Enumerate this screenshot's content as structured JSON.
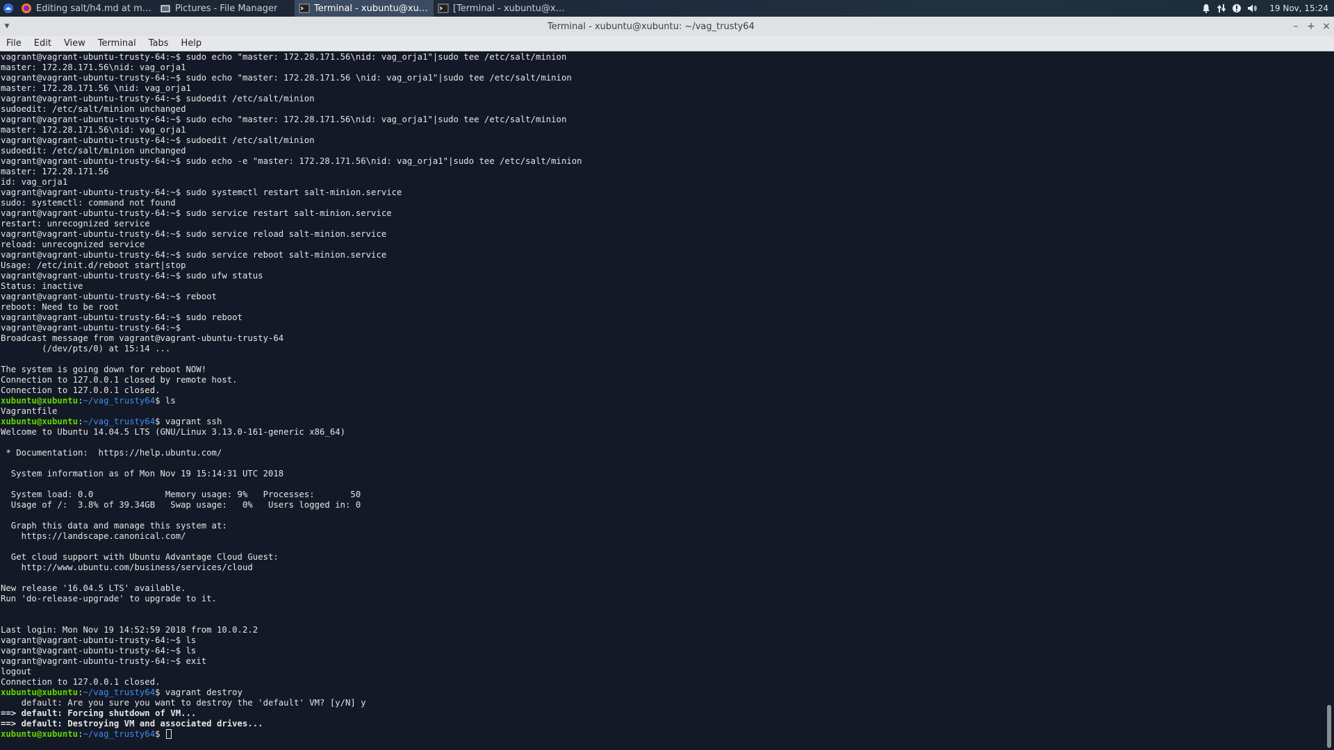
{
  "taskbar": {
    "tasks": [
      {
        "label": "Editing salt/h4.md at master ...",
        "icon": "firefox-icon",
        "active": false
      },
      {
        "label": "Pictures - File Manager",
        "icon": "file-manager-icon",
        "active": false
      },
      {
        "label": "Terminal - xubuntu@xubuntu...",
        "icon": "terminal-icon",
        "active": true
      },
      {
        "label": "[Terminal - xubuntu@xubunt...",
        "icon": "terminal-icon",
        "active": false
      }
    ],
    "tray_icons": [
      "bell-icon",
      "network-icon",
      "update-icon",
      "volume-icon"
    ],
    "clock": "19 Nov, 15:24"
  },
  "window": {
    "title": "Terminal - xubuntu@xubuntu: ~/vag_trusty64",
    "controls": {
      "minimize": "–",
      "maximize": "+",
      "close": "×"
    }
  },
  "menubar": {
    "items": [
      "File",
      "Edit",
      "View",
      "Terminal",
      "Tabs",
      "Help"
    ]
  },
  "colors": {
    "terminal_bg": "#131926",
    "prompt_user": "#5fd700",
    "prompt_path": "#3f8df0",
    "text": "#e6e6e6"
  },
  "terminal": {
    "lines": [
      {
        "text": "vagrant@vagrant-ubuntu-trusty-64:~$ sudo echo \"master: 172.28.171.56\\nid: vag_orja1\"|sudo tee /etc/salt/minion"
      },
      {
        "text": "master: 172.28.171.56\\nid: vag_orja1"
      },
      {
        "text": "vagrant@vagrant-ubuntu-trusty-64:~$ sudo echo \"master: 172.28.171.56 \\nid: vag_orja1\"|sudo tee /etc/salt/minion"
      },
      {
        "text": "master: 172.28.171.56 \\nid: vag_orja1"
      },
      {
        "text": "vagrant@vagrant-ubuntu-trusty-64:~$ sudoedit /etc/salt/minion"
      },
      {
        "text": "sudoedit: /etc/salt/minion unchanged"
      },
      {
        "text": "vagrant@vagrant-ubuntu-trusty-64:~$ sudo echo \"master: 172.28.171.56\\nid: vag_orja1\"|sudo tee /etc/salt/minion"
      },
      {
        "text": "master: 172.28.171.56\\nid: vag_orja1"
      },
      {
        "text": "vagrant@vagrant-ubuntu-trusty-64:~$ sudoedit /etc/salt/minion"
      },
      {
        "text": "sudoedit: /etc/salt/minion unchanged"
      },
      {
        "text": "vagrant@vagrant-ubuntu-trusty-64:~$ sudo echo -e \"master: 172.28.171.56\\nid: vag_orja1\"|sudo tee /etc/salt/minion"
      },
      {
        "text": "master: 172.28.171.56"
      },
      {
        "text": "id: vag_orja1"
      },
      {
        "text": "vagrant@vagrant-ubuntu-trusty-64:~$ sudo systemctl restart salt-minion.service"
      },
      {
        "text": "sudo: systemctl: command not found"
      },
      {
        "text": "vagrant@vagrant-ubuntu-trusty-64:~$ sudo service restart salt-minion.service"
      },
      {
        "text": "restart: unrecognized service"
      },
      {
        "text": "vagrant@vagrant-ubuntu-trusty-64:~$ sudo service reload salt-minion.service"
      },
      {
        "text": "reload: unrecognized service"
      },
      {
        "text": "vagrant@vagrant-ubuntu-trusty-64:~$ sudo service reboot salt-minion.service"
      },
      {
        "text": "Usage: /etc/init.d/reboot start|stop"
      },
      {
        "text": "vagrant@vagrant-ubuntu-trusty-64:~$ sudo ufw status"
      },
      {
        "text": "Status: inactive"
      },
      {
        "text": "vagrant@vagrant-ubuntu-trusty-64:~$ reboot"
      },
      {
        "text": "reboot: Need to be root"
      },
      {
        "text": "vagrant@vagrant-ubuntu-trusty-64:~$ sudo reboot"
      },
      {
        "text": "vagrant@vagrant-ubuntu-trusty-64:~$"
      },
      {
        "text": "Broadcast message from vagrant@vagrant-ubuntu-trusty-64"
      },
      {
        "text": "        (/dev/pts/0) at 15:14 ..."
      },
      {
        "text": ""
      },
      {
        "text": "The system is going down for reboot NOW!"
      },
      {
        "text": "Connection to 127.0.0.1 closed by remote host."
      },
      {
        "text": "Connection to 127.0.0.1 closed."
      },
      {
        "user": "xubuntu@xubuntu",
        "path": "~/vag_trusty64",
        "cmd": "$ ls"
      },
      {
        "text": "Vagrantfile"
      },
      {
        "user": "xubuntu@xubuntu",
        "path": "~/vag_trusty64",
        "cmd": "$ vagrant ssh"
      },
      {
        "text": "Welcome to Ubuntu 14.04.5 LTS (GNU/Linux 3.13.0-161-generic x86_64)"
      },
      {
        "text": ""
      },
      {
        "text": " * Documentation:  https://help.ubuntu.com/"
      },
      {
        "text": ""
      },
      {
        "text": "  System information as of Mon Nov 19 15:14:31 UTC 2018"
      },
      {
        "text": ""
      },
      {
        "text": "  System load: 0.0              Memory usage: 9%   Processes:       50"
      },
      {
        "text": "  Usage of /:  3.8% of 39.34GB   Swap usage:   0%   Users logged in: 0"
      },
      {
        "text": ""
      },
      {
        "text": "  Graph this data and manage this system at:"
      },
      {
        "text": "    https://landscape.canonical.com/"
      },
      {
        "text": ""
      },
      {
        "text": "  Get cloud support with Ubuntu Advantage Cloud Guest:"
      },
      {
        "text": "    http://www.ubuntu.com/business/services/cloud"
      },
      {
        "text": ""
      },
      {
        "text": "New release '16.04.5 LTS' available."
      },
      {
        "text": "Run 'do-release-upgrade' to upgrade to it."
      },
      {
        "text": ""
      },
      {
        "text": ""
      },
      {
        "text": "Last login: Mon Nov 19 14:52:59 2018 from 10.0.2.2"
      },
      {
        "text": "vagrant@vagrant-ubuntu-trusty-64:~$ ls"
      },
      {
        "text": "vagrant@vagrant-ubuntu-trusty-64:~$ ls"
      },
      {
        "text": "vagrant@vagrant-ubuntu-trusty-64:~$ exit"
      },
      {
        "text": "logout"
      },
      {
        "text": "Connection to 127.0.0.1 closed."
      },
      {
        "user": "xubuntu@xubuntu",
        "path": "~/vag_trusty64",
        "cmd": "$ vagrant destroy"
      },
      {
        "text": "    default: Are you sure you want to destroy the 'default' VM? [y/N] y"
      },
      {
        "text": "==> default: Forcing shutdown of VM...",
        "bold": true
      },
      {
        "text": "==> default: Destroying VM and associated drives...",
        "bold": true
      },
      {
        "user": "xubuntu@xubuntu",
        "path": "~/vag_trusty64",
        "cmd": "$ ",
        "cursor": true
      }
    ]
  }
}
